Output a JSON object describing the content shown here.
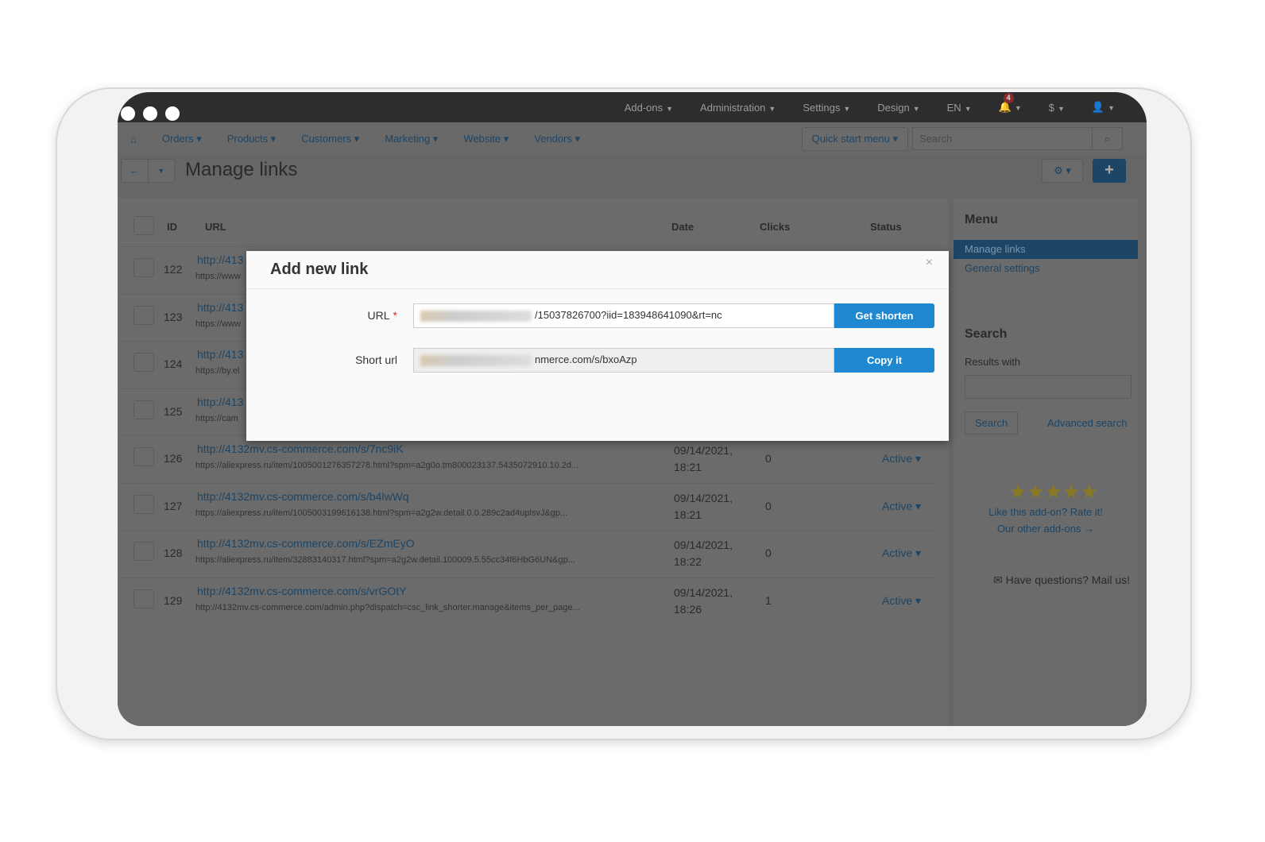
{
  "topbar": {
    "items": [
      "Add-ons",
      "Administration",
      "Settings",
      "Design",
      "EN"
    ],
    "notifications": "4",
    "currency": "$"
  },
  "nav": {
    "items": [
      "Orders",
      "Products",
      "Customers",
      "Marketing",
      "Website",
      "Vendors"
    ],
    "quick_start": "Quick start menu",
    "search_placeholder": "Search"
  },
  "page": {
    "title": "Manage links"
  },
  "table": {
    "headers": {
      "id": "ID",
      "url": "URL",
      "date": "Date",
      "clicks": "Clicks",
      "status": "Status"
    },
    "rows": [
      {
        "id": "122",
        "short": "http://413",
        "long": "https://www",
        "date": "",
        "time": "",
        "clicks": "",
        "status": ""
      },
      {
        "id": "123",
        "short": "http://413",
        "long": "https://www",
        "date": "",
        "time": "",
        "clicks": "",
        "status": ""
      },
      {
        "id": "124",
        "short": "http://413",
        "long": "https://by.el",
        "date": "",
        "time": "",
        "clicks": "",
        "status": ""
      },
      {
        "id": "125",
        "short": "http://413",
        "long": "https://cam",
        "date": "",
        "time": "",
        "clicks": "",
        "status": ""
      },
      {
        "id": "126",
        "short": "http://4132mv.cs-commerce.com/s/7nc9iK",
        "long": "https://aliexpress.ru/item/1005001276357278.html?spm=a2g0o.tm800023137.5435072910.10.2d...",
        "date": "09/14/2021,",
        "time": "18:21",
        "clicks": "0",
        "status": "Active"
      },
      {
        "id": "127",
        "short": "http://4132mv.cs-commerce.com/s/b4lwWq",
        "long": "https://aliexpress.ru/item/1005003199616138.html?spm=a2g2w.detail.0.0.289c2ad4uplsvJ&gp...",
        "date": "09/14/2021,",
        "time": "18:21",
        "clicks": "0",
        "status": "Active"
      },
      {
        "id": "128",
        "short": "http://4132mv.cs-commerce.com/s/EZmEyO",
        "long": "https://aliexpress.ru/item/32883140317.html?spm=a2g2w.detail.100009.5.55cc34f6HbG6UN&gp...",
        "date": "09/14/2021,",
        "time": "18:22",
        "clicks": "0",
        "status": "Active"
      },
      {
        "id": "129",
        "short": "http://4132mv.cs-commerce.com/s/vrGOtY",
        "long": "http://4132mv.cs-commerce.com/admin.php?dispatch=csc_link_shorter.manage&items_per_page...",
        "date": "09/14/2021,",
        "time": "18:26",
        "clicks": "1",
        "status": "Active"
      }
    ]
  },
  "sidebar": {
    "title": "Menu",
    "items": [
      "Manage links",
      "General settings"
    ],
    "search_title": "Search",
    "results_with": "Results with",
    "search_btn": "Search",
    "advanced": "Advanced search",
    "stars": "★★★★★",
    "rate": "Like this add-on? Rate it!",
    "other": "Our other add-ons →",
    "mail": "Have questions? Mail us!"
  },
  "modal": {
    "title": "Add new link",
    "close": "×",
    "url_label": "URL",
    "required": "*",
    "url_value": "/15037826700?iid=183948641090&rt=nc",
    "get_shorten": "Get shorten",
    "short_label": "Short url",
    "short_value": "nmerce.com/s/bxoAzp",
    "copy": "Copy it"
  }
}
